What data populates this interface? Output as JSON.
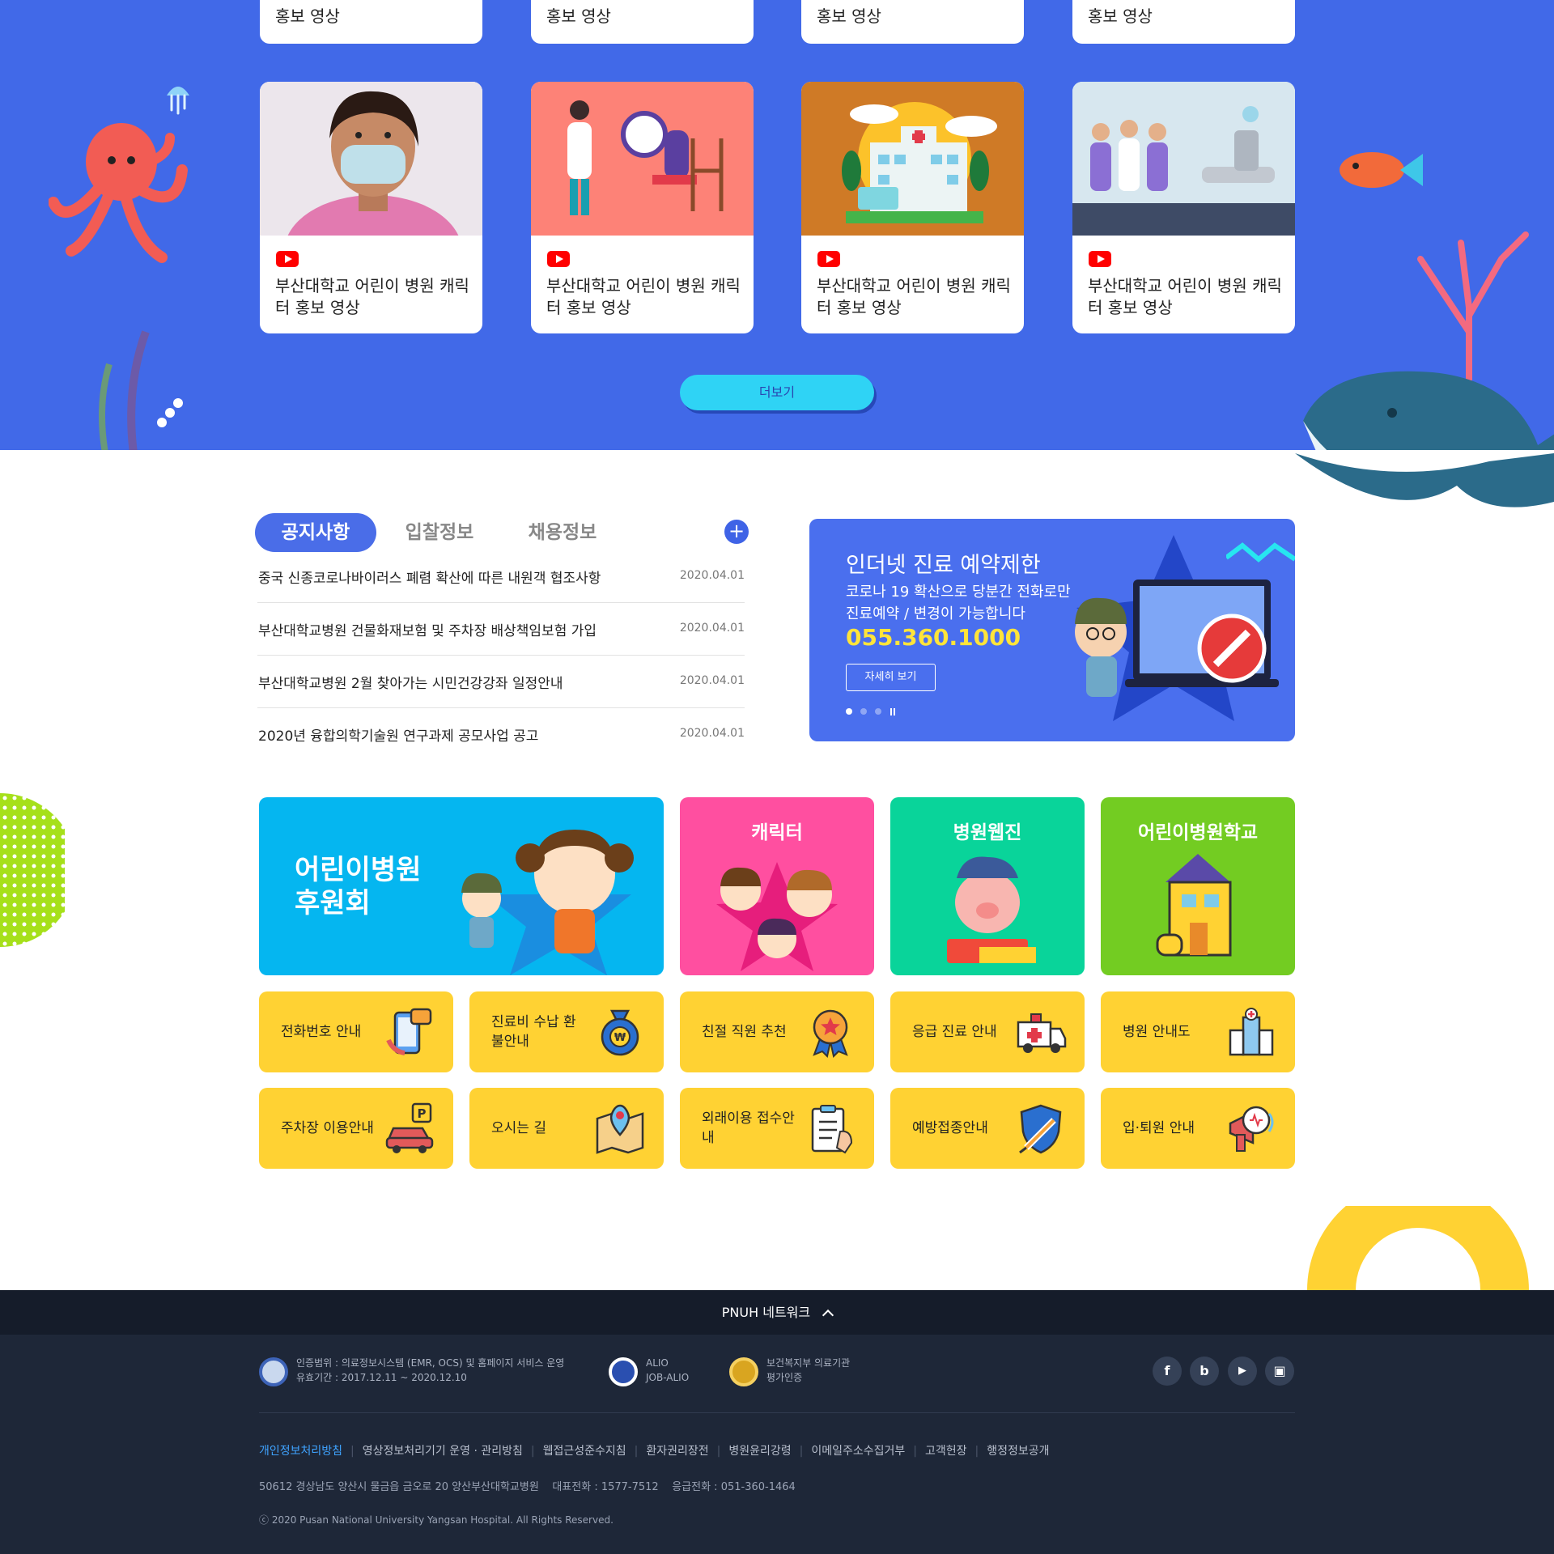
{
  "video_section": {
    "top_cards": [
      {
        "title": "홍보 영상"
      },
      {
        "title": "홍보 영상"
      },
      {
        "title": "홍보 영상"
      },
      {
        "title": "홍보 영상"
      }
    ],
    "cards": [
      {
        "title": "부산대학교 어린이 병원 캐릭터 홍보 영상",
        "thumb": "masked-woman"
      },
      {
        "title": "부산대학교 어린이 병원 캐릭터 홍보 영상",
        "thumb": "doctor-examination"
      },
      {
        "title": "부산대학교 어린이 병원 캐릭터 홍보 영상",
        "thumb": "hospital-building"
      },
      {
        "title": "부산대학교 어린이 병원 캐릭터 홍보 영상",
        "thumb": "medical-staff"
      }
    ],
    "more_label": "더보기"
  },
  "news": {
    "tabs": [
      {
        "label": "공지사항",
        "active": true
      },
      {
        "label": "입찰정보",
        "active": false
      },
      {
        "label": "채용정보",
        "active": false
      }
    ],
    "plus_label": "+",
    "items": [
      {
        "title": "중국 신종코로나바이러스 폐렴 확산에 따른 내원객 협조사항",
        "date": "2020.04.01"
      },
      {
        "title": "부산대학교병원 건물화재보험 및 주차장 배상책임보험 가입",
        "date": "2020.04.01"
      },
      {
        "title": "부산대학교병원 2월 찾아가는 시민건강강좌 일정안내",
        "date": "2020.04.01"
      },
      {
        "title": "2020년 융합의학기술원 연구과제 공모사업 공고",
        "date": "2020.04.01"
      }
    ]
  },
  "banner": {
    "title": "인더넷 진료 예약제한",
    "desc_line1": "코로나 19 확산으로 당분간 전화로만",
    "desc_line2": "진료예약 / 변경이 가능합니다",
    "phone": "055.360.1000",
    "button_label": "자세히 보기"
  },
  "big_tiles": {
    "sponsor_line1": "어린이병원",
    "sponsor_line2": "후원회",
    "character": "캐릭터",
    "webzine": "병원웹진",
    "school": "어린이병원학교"
  },
  "quick_tiles": [
    {
      "label": "전화번호 안내",
      "icon": "phone-chat-icon"
    },
    {
      "label": "진료비 수납 환불안내",
      "icon": "money-bag-icon"
    },
    {
      "label": "친절 직원 추천",
      "icon": "award-medal-icon"
    },
    {
      "label": "응급 진료 안내",
      "icon": "ambulance-icon"
    },
    {
      "label": "병원 안내도",
      "icon": "hospital-building-icon"
    },
    {
      "label": "주차장 이용안내",
      "icon": "parking-car-icon"
    },
    {
      "label": "오시는 길",
      "icon": "map-pin-icon"
    },
    {
      "label": "외래이용 접수안내",
      "icon": "clipboard-icon"
    },
    {
      "label": "예방접종안내",
      "icon": "vaccine-shield-icon"
    },
    {
      "label": "입·퇴원 안내",
      "icon": "megaphone-icon"
    }
  ],
  "footer": {
    "network_label": "PNUH 네트워크",
    "cert1_line1": "인증범위 : 의료정보시스템 (EMR, OCS) 및 홈페이지 서비스 운영",
    "cert1_line2": "유효기간 : 2017.12.11 ~ 2020.12.10",
    "cert2_line1": "ALIO",
    "cert2_line2": "JOB-ALIO",
    "cert3_line1": "보건복지부 의료기관",
    "cert3_line2": "평가인증",
    "social": [
      "f",
      "b",
      "▶",
      "▣"
    ],
    "links": [
      "개인정보처리방침",
      "영상정보처리기기 운영 · 관리방침",
      "웹접근성준수지침",
      "환자권리장전",
      "병원윤리강령",
      "이메일주소수집거부",
      "고객헌장",
      "행정정보공개"
    ],
    "address": "50612 경상남도 양산시 물금읍 금오로 20 양산부산대학교병원    대표전화 : 1577-7512    응급전화 : 051-360-1464",
    "copyright": "ⓒ 2020 Pusan National University Yangsan Hospital. All Rights Reserved."
  },
  "colors": {
    "section_blue": "#4169e8",
    "tab_blue": "#4a6de8",
    "quick_yellow": "#ffd233",
    "sponsor_cyan": "#05b6f0",
    "character_pink": "#ff4fa0",
    "webzine_green": "#09d49a",
    "school_green": "#73cc22",
    "footer_dark": "#1e2738"
  }
}
